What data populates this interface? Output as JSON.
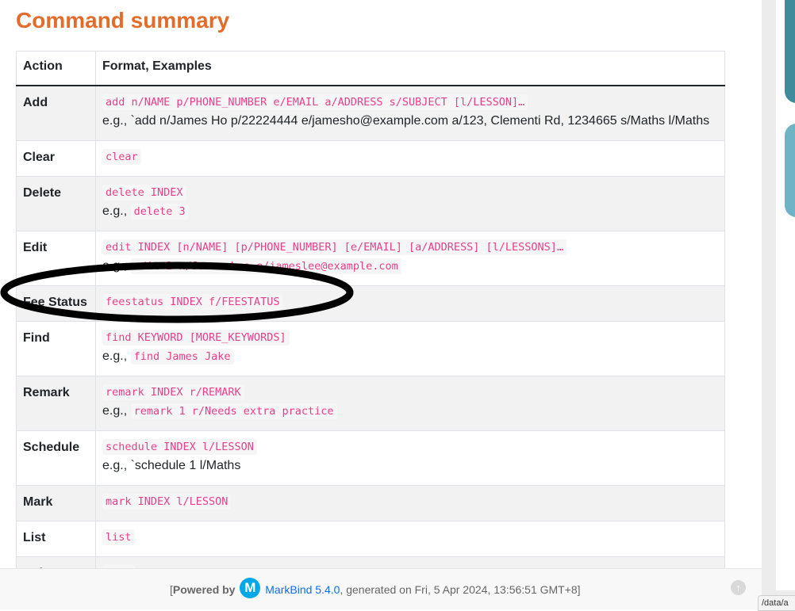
{
  "page": {
    "title": "Command summary",
    "table": {
      "headers": [
        "Action",
        "Format, Examples"
      ],
      "rows": [
        {
          "action": "Add",
          "format": "add n/NAME p/PHONE_NUMBER e/EMAIL a/ADDRESS s/SUBJECT [l/LESSON]…",
          "example_prefix": "e.g., ",
          "example": "`add n/James Ho p/22224444 e/jamesho@example.com a/123, Clementi Rd, 1234665 s/Maths l/Maths"
        },
        {
          "action": "Clear",
          "format": "clear"
        },
        {
          "action": "Delete",
          "format": "delete INDEX",
          "example_prefix": "e.g., ",
          "example_code": "delete 3"
        },
        {
          "action": "Edit",
          "format": "edit INDEX [n/NAME] [p/PHONE_NUMBER] [e/EMAIL] [a/ADDRESS] [l/LESSONS]…",
          "example_prefix": "e.g., ",
          "example_code": "edit 2 n/James Lee e/jameslee@example.com"
        },
        {
          "action": "Fee Status",
          "format": "feestatus INDEX f/FEESTATUS"
        },
        {
          "action": "Find",
          "format": "find KEYWORD [MORE_KEYWORDS]",
          "example_prefix": "e.g., ",
          "example_code": "find James Jake"
        },
        {
          "action": "Remark",
          "format": "remark INDEX r/REMARK",
          "example_prefix": "e.g., ",
          "example_code": "remark 1 r/Needs extra practice"
        },
        {
          "action": "Schedule",
          "format": "schedule INDEX l/LESSON",
          "example_prefix": "e.g., ",
          "example": "`schedule 1 l/Maths"
        },
        {
          "action": "Mark",
          "format": "mark INDEX l/LESSON"
        },
        {
          "action": "List",
          "format": "list"
        },
        {
          "action": "Help",
          "format": "help"
        }
      ]
    }
  },
  "footer": {
    "open_bracket": "[",
    "powered_by": "Powered by",
    "logo_letter": "M",
    "markbind_link": "MarkBind 5.4.0",
    "generated": ", generated on Fri, 5 Apr 2024, 13:56:51 GMT+8]",
    "up_icon": "↑"
  },
  "status_bar": {
    "path": "/data/a"
  },
  "colors": {
    "title": "#e46c2a",
    "code": "#e83e8c",
    "accent_tile_1": "#3f8a9b",
    "accent_tile_2": "#6fb3c6",
    "annotation_oval": "#000000"
  }
}
